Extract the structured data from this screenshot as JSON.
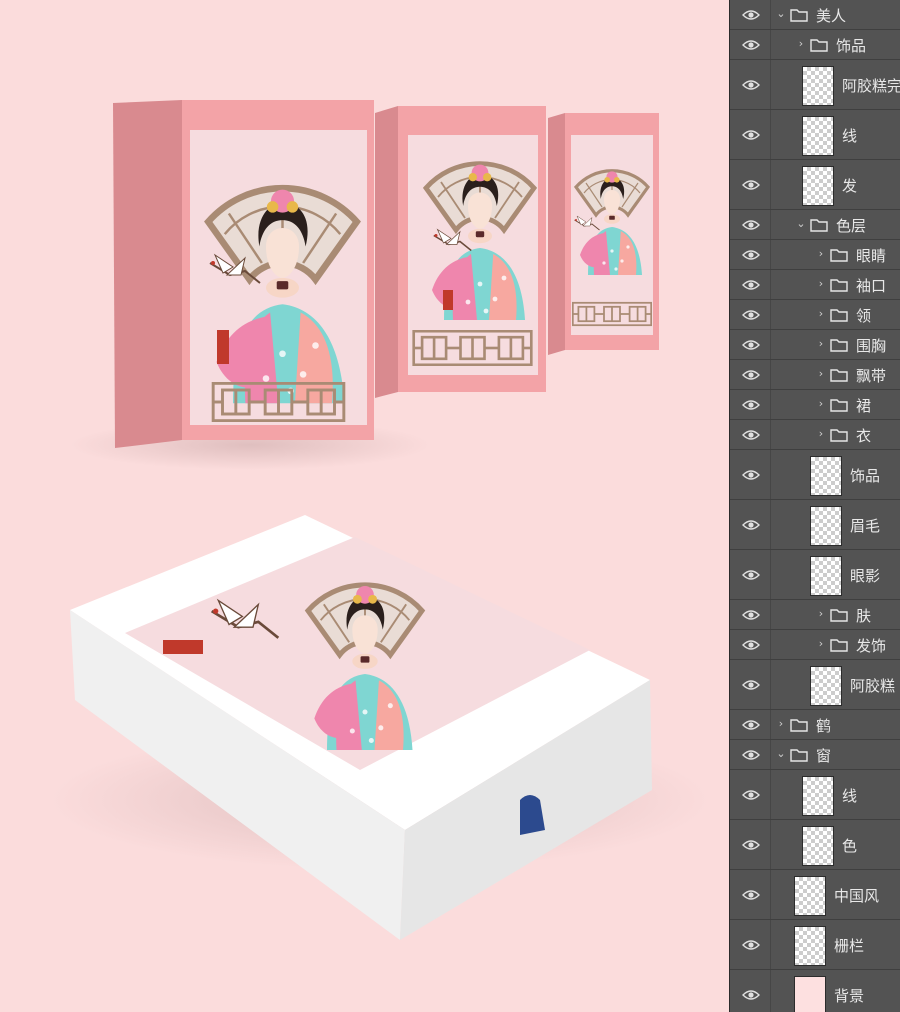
{
  "layers": [
    {
      "name": "美人",
      "kind": "group",
      "expanded": true,
      "depth": 0
    },
    {
      "name": "饰品",
      "kind": "group",
      "expanded": false,
      "depth": 1
    },
    {
      "name": "阿胶糕完",
      "kind": "layer",
      "depth": 1
    },
    {
      "name": "线",
      "kind": "layer",
      "depth": 1
    },
    {
      "name": "发",
      "kind": "layer",
      "depth": 1
    },
    {
      "name": "色层",
      "kind": "group",
      "expanded": true,
      "depth": 1
    },
    {
      "name": "眼睛",
      "kind": "group",
      "expanded": false,
      "depth": 2
    },
    {
      "name": "袖口",
      "kind": "group",
      "expanded": false,
      "depth": 2
    },
    {
      "name": "领",
      "kind": "group",
      "expanded": false,
      "depth": 2
    },
    {
      "name": "围胸",
      "kind": "group",
      "expanded": false,
      "depth": 2
    },
    {
      "name": "飘带",
      "kind": "group",
      "expanded": false,
      "depth": 2
    },
    {
      "name": "裙",
      "kind": "group",
      "expanded": false,
      "depth": 2
    },
    {
      "name": "衣",
      "kind": "group",
      "expanded": false,
      "depth": 2
    },
    {
      "name": "饰品",
      "kind": "layer",
      "depth": 2
    },
    {
      "name": "眉毛",
      "kind": "layer",
      "depth": 2
    },
    {
      "name": "眼影",
      "kind": "layer",
      "depth": 2
    },
    {
      "name": "肤",
      "kind": "group",
      "expanded": false,
      "depth": 2
    },
    {
      "name": "发饰",
      "kind": "group",
      "expanded": false,
      "depth": 2
    },
    {
      "name": "阿胶糕",
      "kind": "layer",
      "depth": 2
    },
    {
      "name": "鹤",
      "kind": "group",
      "expanded": false,
      "depth": 0
    },
    {
      "name": "窗",
      "kind": "group",
      "expanded": true,
      "depth": 0
    },
    {
      "name": "线",
      "kind": "layer",
      "depth": 1
    },
    {
      "name": "色",
      "kind": "layer",
      "depth": 1
    },
    {
      "name": "中国风",
      "kind": "layer",
      "depth": 0
    },
    {
      "name": "栅栏",
      "kind": "layer",
      "depth": 0
    },
    {
      "name": "背景",
      "kind": "layer",
      "depth": 0,
      "fill": "#fde0e0"
    }
  ],
  "colors": {
    "canvas_bg": "#fbdcdc",
    "panel_bg": "#535353",
    "box_pink": "#f3a3a7",
    "box_inner": "#f6dcdf",
    "fan_brown": "#a98b74",
    "robe_teal": "#7fd6d2",
    "robe_pink": "#ef86ad",
    "ribbon_blue": "#2c4a8e"
  }
}
